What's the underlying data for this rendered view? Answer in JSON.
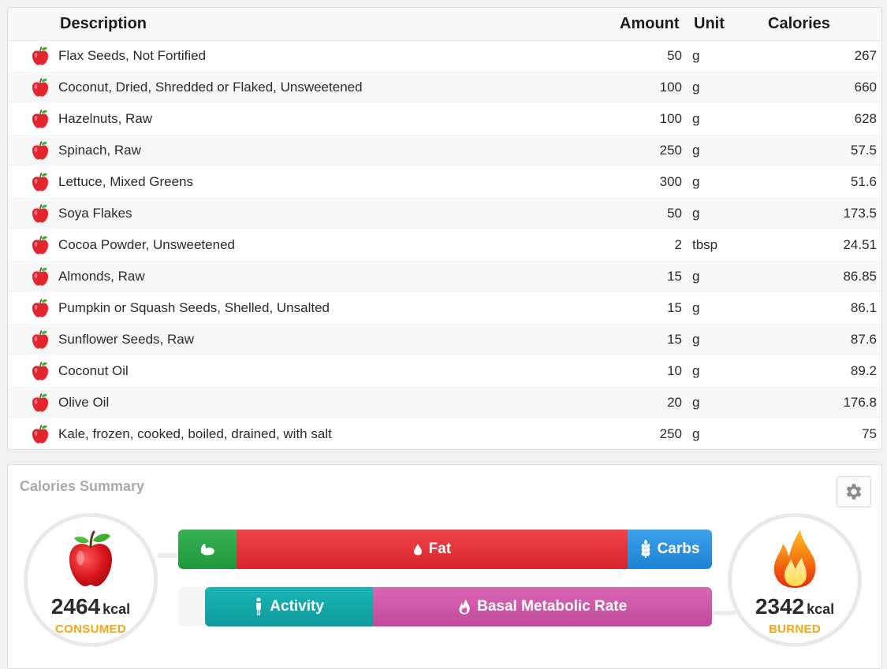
{
  "table": {
    "headers": {
      "description": "Description",
      "amount": "Amount",
      "unit": "Unit",
      "calories": "Calories"
    },
    "rows": [
      {
        "description": "Flax Seeds, Not Fortified",
        "amount": "50",
        "unit": "g",
        "calories": "267"
      },
      {
        "description": "Coconut, Dried, Shredded or Flaked, Unsweetened",
        "amount": "100",
        "unit": "g",
        "calories": "660"
      },
      {
        "description": "Hazelnuts, Raw",
        "amount": "100",
        "unit": "g",
        "calories": "628"
      },
      {
        "description": "Spinach, Raw",
        "amount": "250",
        "unit": "g",
        "calories": "57.5"
      },
      {
        "description": "Lettuce, Mixed Greens",
        "amount": "300",
        "unit": "g",
        "calories": "51.6"
      },
      {
        "description": "Soya Flakes",
        "amount": "50",
        "unit": "g",
        "calories": "173.5"
      },
      {
        "description": "Cocoa Powder, Unsweetened",
        "amount": "2",
        "unit": "tbsp",
        "calories": "24.51"
      },
      {
        "description": "Almonds, Raw",
        "amount": "15",
        "unit": "g",
        "calories": "86.85"
      },
      {
        "description": "Pumpkin or Squash Seeds, Shelled, Unsalted",
        "amount": "15",
        "unit": "g",
        "calories": "86.1"
      },
      {
        "description": "Sunflower Seeds, Raw",
        "amount": "15",
        "unit": "g",
        "calories": "87.6"
      },
      {
        "description": "Coconut Oil",
        "amount": "10",
        "unit": "g",
        "calories": "89.2"
      },
      {
        "description": "Olive Oil",
        "amount": "20",
        "unit": "g",
        "calories": "176.8"
      },
      {
        "description": "Kale, frozen, cooked, boiled, drained, with salt",
        "amount": "250",
        "unit": "g",
        "calories": "75"
      }
    ]
  },
  "summary": {
    "title": "Calories Summary",
    "consumed": {
      "value": "2464",
      "unit": "kcal",
      "label": "CONSUMED"
    },
    "burned": {
      "value": "2342",
      "unit": "kcal",
      "label": "BURNED"
    },
    "macro_bar": {
      "protein_label": "",
      "fat_label": "Fat",
      "carbs_label": "Carbs",
      "protein_fraction": 0.109,
      "fat_fraction": 0.733,
      "carbs_fraction": 0.158
    },
    "burn_bar": {
      "activity_label": "Activity",
      "bmr_label": "Basal Metabolic Rate",
      "activity_fraction": 0.332,
      "bmr_fraction": 0.668,
      "burned_fraction_of_consumed": 0.95
    },
    "colors": {
      "protein": "#2ba546",
      "fat": "#e5343b",
      "carbs": "#2b91de",
      "activity": "#13a8a9",
      "bmr": "#cd58a9",
      "accent_label": "#f3a712"
    }
  }
}
